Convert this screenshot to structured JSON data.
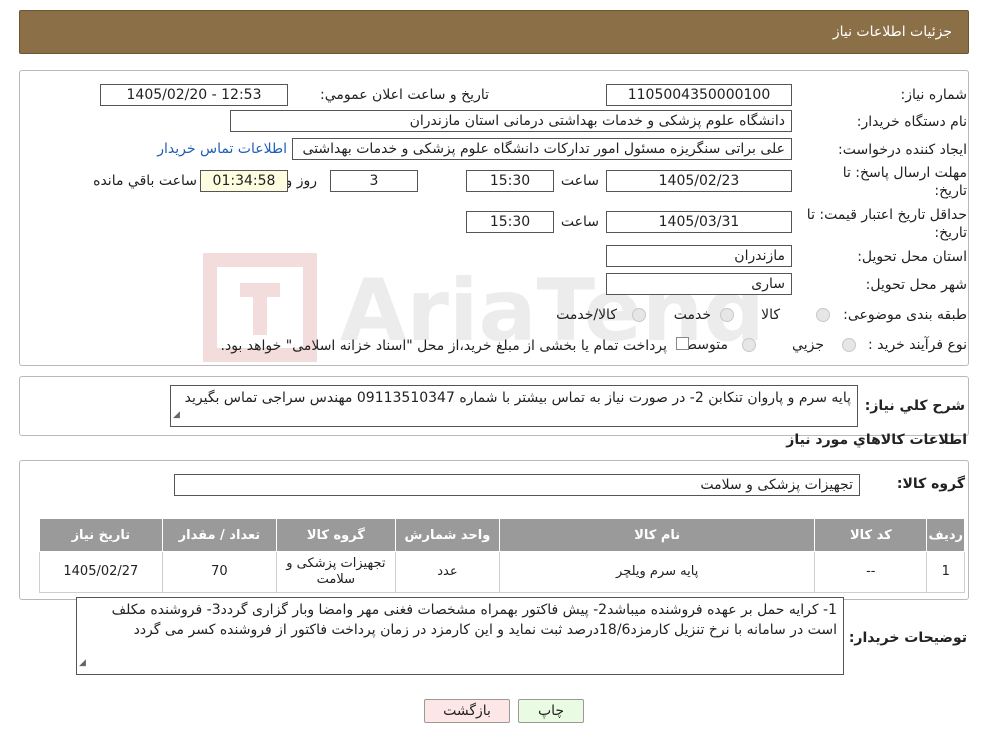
{
  "header": {
    "title": "جزئیات اطلاعات نیاز"
  },
  "info": {
    "need_number_label": "شماره نیاز:",
    "need_number": "1105004350000100",
    "announce_label": "تاریخ و ساعت اعلان عمومي:",
    "announce_value": "1405/02/20 - 12:53",
    "buyer_org_label": "نام دستگاه خریدار:",
    "buyer_org": "دانشگاه علوم پزشکی و خدمات بهداشتی  درمانی استان مازندران",
    "creator_label": "ایجاد کننده درخواست:",
    "creator": "علی براتی سنگریزه مسئول امور تدارکات دانشگاه علوم پزشکی و خدمات بهداشتی",
    "contact_link": "اطلاعات تماس خریدار",
    "deadline_label_1": "مهلت ارسال پاسخ: تا",
    "deadline_label_2": "تاریخ:",
    "deadline_date": "1405/02/23",
    "time_label": "ساعت",
    "deadline_time": "15:30",
    "days_value": "3",
    "days_label": "روز و",
    "remaining_time": "01:34:58",
    "remaining_label": "ساعت باقي مانده",
    "validity_label_1": "حداقل تاریخ اعتبار قیمت: تا",
    "validity_label_2": "تاریخ:",
    "validity_date": "1405/03/31",
    "validity_time_label": "ساعت",
    "validity_time": "15:30",
    "province_label": "استان محل تحویل:",
    "province": "مازندران",
    "city_label": "شهر محل تحویل:",
    "city": "ساری",
    "category_label": "طبقه بندی موضوعی:",
    "category_options": [
      "کالا",
      "خدمت",
      "کالا/خدمت"
    ],
    "process_label": "نوع فرآیند خرید :",
    "process_options": [
      "جزیي",
      "متوسط"
    ],
    "process_note": "پرداخت تمام یا بخشی از مبلغ خرید،از محل \"اسناد خزانه اسلامی\" خواهد بود."
  },
  "summary": {
    "label": "شرح کلي نیاز:",
    "text": "پایه سرم و پاروان  تنکابن 2- در صورت نیاز به تماس بیشتر با شماره 09113510347 مهندس سراجی تماس بگیرید"
  },
  "goods": {
    "section_title": "اطلاعات کالاهاي مورد نیاز",
    "group_label": "گروه کالا:",
    "group_value": "تجهیزات پزشکی و سلامت",
    "columns": [
      "ردیف",
      "کد کالا",
      "نام کالا",
      "واحد شمارش",
      "گروه کالا",
      "تعداد / مقدار",
      "تاریخ نیاز"
    ],
    "rows": [
      {
        "row": "1",
        "code": "--",
        "name": "پایه سرم ویلچر",
        "unit": "عدد",
        "group": "تجهیزات پزشکی و سلامت",
        "qty": "70",
        "date": "1405/02/27"
      }
    ]
  },
  "buyer_notes": {
    "label": "توضیحات خریدار:",
    "text": "1- کرایه حمل بر عهده فروشنده میباشد2- پیش فاکتور بهمراه مشخصات فغنی مهر وامضا وبار گزاری گردد3- فروشنده مکلف است در سامانه با نرخ تنزیل کارمزد18/6درصد ثبت نماید و این کارمزد در زمان پرداخت فاکتور از فروشنده کسر می گردد"
  },
  "buttons": {
    "print": "چاپ",
    "back": "بازگشت"
  },
  "colors": {
    "header_bg": "#8b6f47",
    "table_header_bg": "#9a9a9a",
    "print_btn_bg": "#eafbe4",
    "back_btn_bg": "#fde6e6"
  }
}
